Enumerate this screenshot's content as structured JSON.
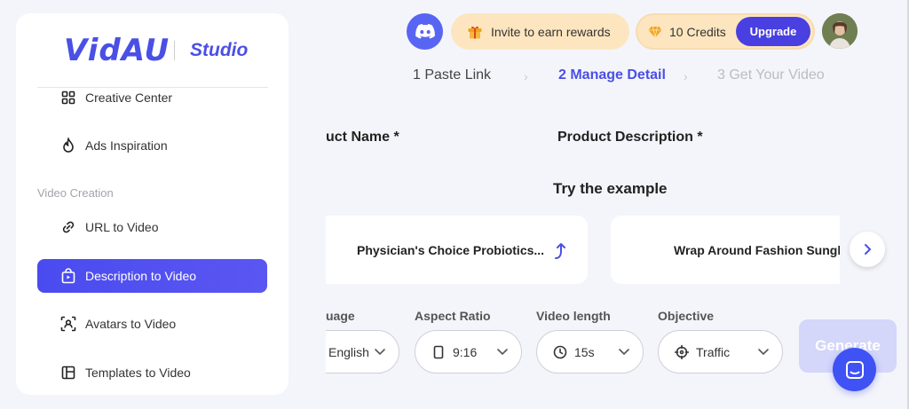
{
  "brand": {
    "logo": "VidAU",
    "product": "Studio"
  },
  "sidebar": {
    "items": [
      {
        "label": "Creative Center",
        "icon": "grid-icon"
      },
      {
        "label": "Ads Inspiration",
        "icon": "flame-icon"
      }
    ],
    "section_label": "Video Creation",
    "creation_items": [
      {
        "label": "URL to Video",
        "icon": "link-icon",
        "active": false
      },
      {
        "label": "Description to Video",
        "icon": "shopping-bag-icon",
        "active": true
      },
      {
        "label": "Avatars to Video",
        "icon": "avatar-scan-icon",
        "active": false
      },
      {
        "label": "Templates to Video",
        "icon": "template-icon",
        "active": false
      }
    ]
  },
  "header": {
    "invite_label": "Invite to earn rewards",
    "credits_label": "10 Credits",
    "upgrade_label": "Upgrade"
  },
  "steps": [
    {
      "label": "1 Paste Link",
      "state": "done"
    },
    {
      "label": "2 Manage Detail",
      "state": "current"
    },
    {
      "label": "3 Get Your Video",
      "state": "todo"
    }
  ],
  "form": {
    "product_name_label": "uct Name *",
    "product_description_label": "Product Description *",
    "try_example_label": "Try the example",
    "examples": [
      {
        "label": "Physician's Choice Probiotics..."
      },
      {
        "label": "Wrap Around Fashion Sungla"
      }
    ],
    "options": {
      "language": {
        "label": "uage",
        "value": "English"
      },
      "aspect_ratio": {
        "label": "Aspect Ratio",
        "value": "9:16"
      },
      "video_length": {
        "label": "Video length",
        "value": "15s"
      },
      "objective": {
        "label": "Objective",
        "value": "Traffic"
      }
    },
    "generate_label": "Generate"
  },
  "colors": {
    "accent": "#4a4fe6",
    "active_item": "#4b4ef2",
    "reward_bg": "#fde6bf",
    "upgrade_bg": "#4a3fe0",
    "discord": "#5865f2",
    "generate_disabled": "#d4d6fa"
  }
}
